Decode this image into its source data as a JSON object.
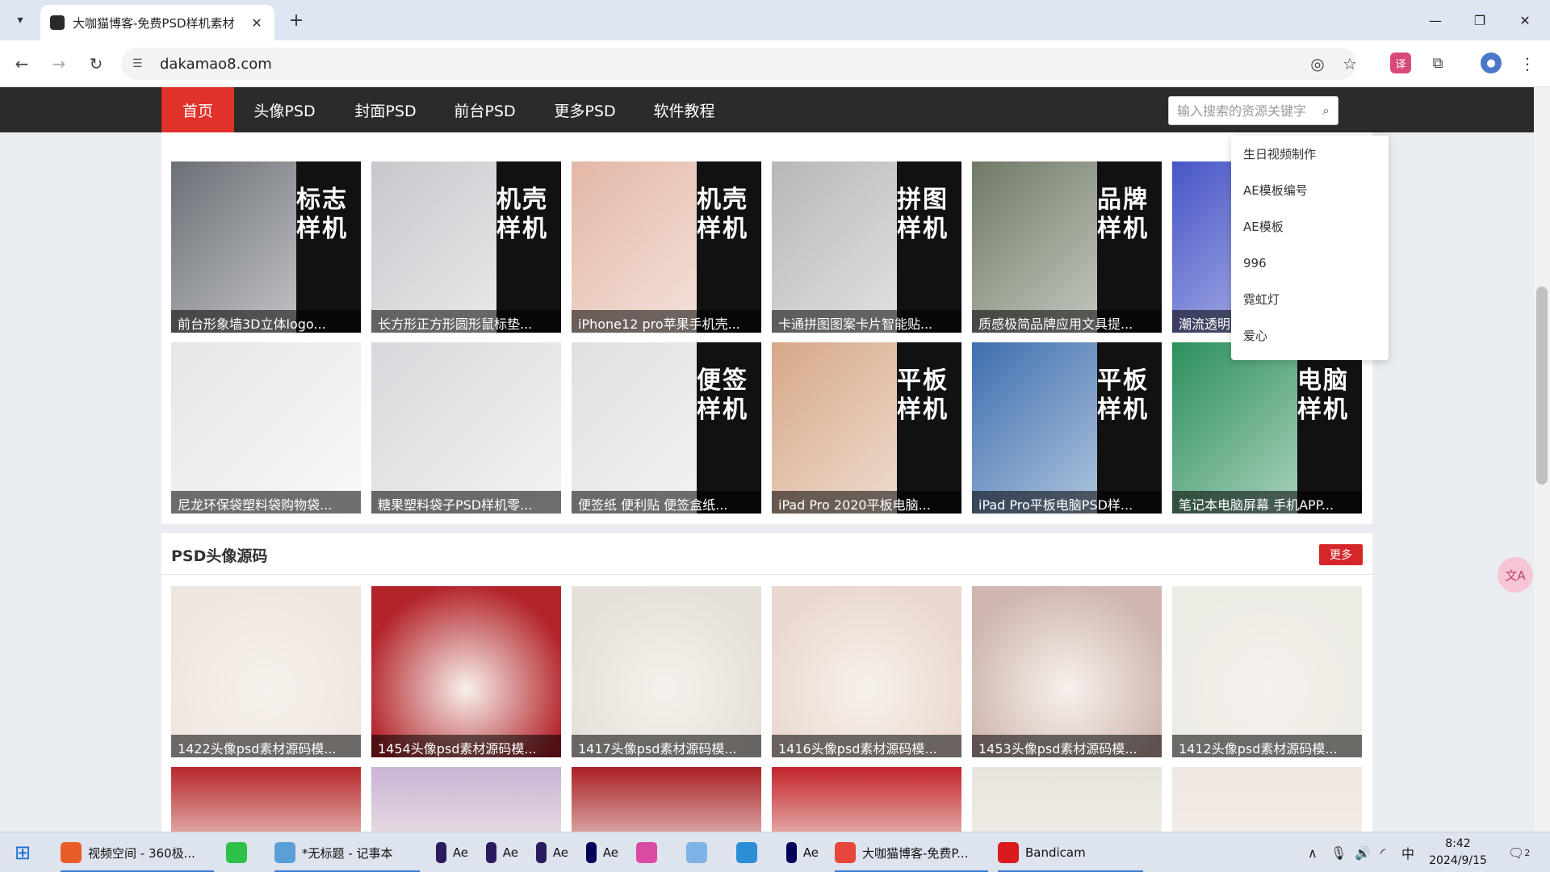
{
  "browser": {
    "tab_title": "大咖猫博客-免费PSD样机素材",
    "url": "dakamao8.com"
  },
  "site_nav": {
    "items": [
      {
        "label": "首页",
        "active": true
      },
      {
        "label": "头像PSD",
        "active": false
      },
      {
        "label": "封面PSD",
        "active": false
      },
      {
        "label": "前台PSD",
        "active": false
      },
      {
        "label": "更多PSD",
        "active": false
      },
      {
        "label": "软件教程",
        "active": false
      }
    ],
    "search_placeholder": "输入搜索的资源关键字"
  },
  "suggestions": [
    "生日视频制作",
    "AE模板编号",
    "AE模板",
    "996",
    "霓虹灯",
    "爱心"
  ],
  "section1": {
    "cards": [
      {
        "caption": "前台形象墙3D立体logo...",
        "badge": "标志样机",
        "color": "#6b6f76"
      },
      {
        "caption": "长方形正方形圆形鼠标垫...",
        "badge": "机壳样机",
        "color": "#c9c7cc"
      },
      {
        "caption": "iPhone12 pro苹果手机壳...",
        "badge": "机壳样机",
        "color": "#e3b7a6"
      },
      {
        "caption": "卡通拼图图案卡片智能贴...",
        "badge": "拼图样机",
        "color": "#b9b6b6"
      },
      {
        "caption": "质感极简品牌应用文具提...",
        "badge": "品牌样机",
        "color": "#6f7a66"
      },
      {
        "caption": "潮流透明...",
        "badge": "",
        "color": "#4755c7"
      },
      {
        "caption": "尼龙环保袋塑料袋购物袋...",
        "badge": "",
        "color": "#e6e6e6"
      },
      {
        "caption": "糖果塑料袋子PSD样机零...",
        "badge": "",
        "color": "#d8d8dc"
      },
      {
        "caption": "便签纸 便利贴 便签盒纸...",
        "badge": "便签样机",
        "color": "#e0e0e2"
      },
      {
        "caption": "iPad Pro 2020平板电脑...",
        "badge": "平板样机",
        "color": "#d6a888"
      },
      {
        "caption": "iPad Pro平板电脑PSD样...",
        "badge": "平板样机",
        "color": "#3e6fae"
      },
      {
        "caption": "笔记本电脑屏幕 手机APP...",
        "badge": "电脑样机",
        "color": "#2c8f5c"
      }
    ]
  },
  "section2": {
    "title": "PSD头像源码",
    "more": "更多",
    "cards": [
      {
        "caption": "1422头像psd素材源码模...",
        "color": "#efe6e0"
      },
      {
        "caption": "1454头像psd素材源码模...",
        "color": "#b3232a"
      },
      {
        "caption": "1417头像psd素材源码模...",
        "color": "#e6e0da"
      },
      {
        "caption": "1416头像psd素材源码模...",
        "color": "#ead9d0"
      },
      {
        "caption": "1453头像psd素材源码模...",
        "color": "#cfb7b0"
      },
      {
        "caption": "1412头像psd素材源码模...",
        "color": "#ecebe4"
      }
    ],
    "row2_colors": [
      "#b8262b",
      "#c9b3d4",
      "#a91f24",
      "#c4242a",
      "#e8e4de",
      "#efe7e2"
    ]
  },
  "taskbar": {
    "items": [
      {
        "label": "视频空间 - 360极...",
        "color": "#e85d2a"
      },
      {
        "label": "",
        "color": "#2dc14a"
      },
      {
        "label": "*无标题 - 记事本",
        "color": "#5a9fd6"
      },
      {
        "label": "Ae",
        "color": "#2a1b5e"
      },
      {
        "label": "Ae",
        "color": "#2a1b5e"
      },
      {
        "label": "Ae",
        "color": "#2a1b5e"
      },
      {
        "label": "Ae",
        "color": "#00005b"
      },
      {
        "label": "",
        "color": "#d94aa3"
      },
      {
        "label": "",
        "color": "#7fb3e8"
      },
      {
        "label": "",
        "color": "#2b8fd6"
      },
      {
        "label": "Ae",
        "color": "#00005b"
      },
      {
        "label": "大咖猫博客-免费P...",
        "color": "#e8453c"
      },
      {
        "label": "Bandicam",
        "color": "#d91b1b"
      }
    ],
    "ime": "中",
    "time": "8:42",
    "date": "2024/9/15",
    "notif_count": "2"
  }
}
